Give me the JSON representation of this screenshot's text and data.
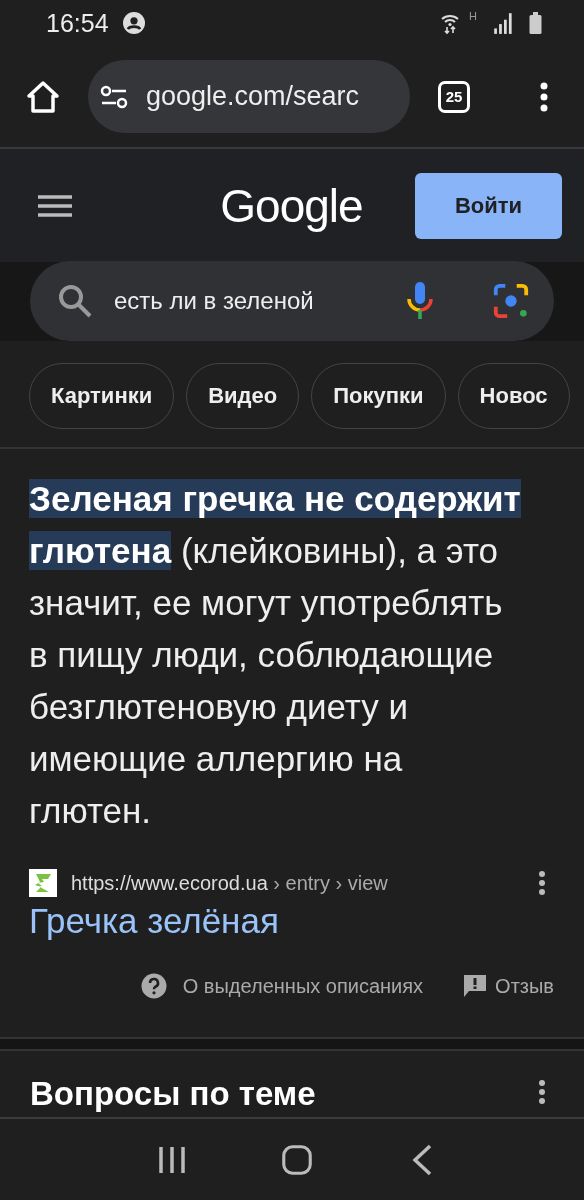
{
  "status_bar": {
    "time": "16:54",
    "network": "H"
  },
  "browser": {
    "url": "google.com/searc",
    "tab_count": "25"
  },
  "header": {
    "logo": "Google",
    "sign_in": "Войти"
  },
  "search": {
    "value": "есть ли в зеленой"
  },
  "chips": [
    {
      "label": "Картинки"
    },
    {
      "label": "Видео"
    },
    {
      "label": "Покупки"
    },
    {
      "label": "Новос"
    }
  ],
  "snippet": {
    "highlight": "Зеленая гречка не содержит глютена",
    "text": " (клейковины), а это значит, ее могут употреблять в пищу люди, соблюдающие безглютеновую диету и имеющие аллергию на глютен."
  },
  "source": {
    "url": "https://www.ecorod.ua",
    "path": " › entry › view",
    "title": "Гречка зелёная"
  },
  "footer_links": [
    "О выделенных описаниях",
    "Отзыв"
  ],
  "next_section": {
    "title": "Вопросы по теме"
  }
}
